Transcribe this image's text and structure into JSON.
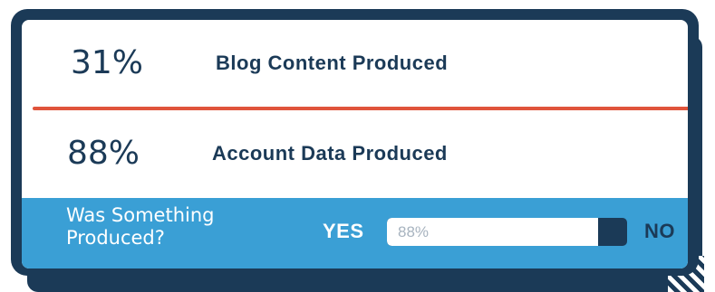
{
  "stats": [
    {
      "value": "31%",
      "label": "Blog Content Produced"
    },
    {
      "value": "88%",
      "label": "Account Data Produced"
    }
  ],
  "poll": {
    "question": "Was Something Produced?",
    "yes_label": "YES",
    "no_label": "NO",
    "progress_text": "88%",
    "progress_fraction": 0.88
  },
  "colors": {
    "navy": "#1b3a57",
    "accent_red": "#e0543b",
    "band_blue": "#3a9fd5",
    "white": "#ffffff"
  }
}
